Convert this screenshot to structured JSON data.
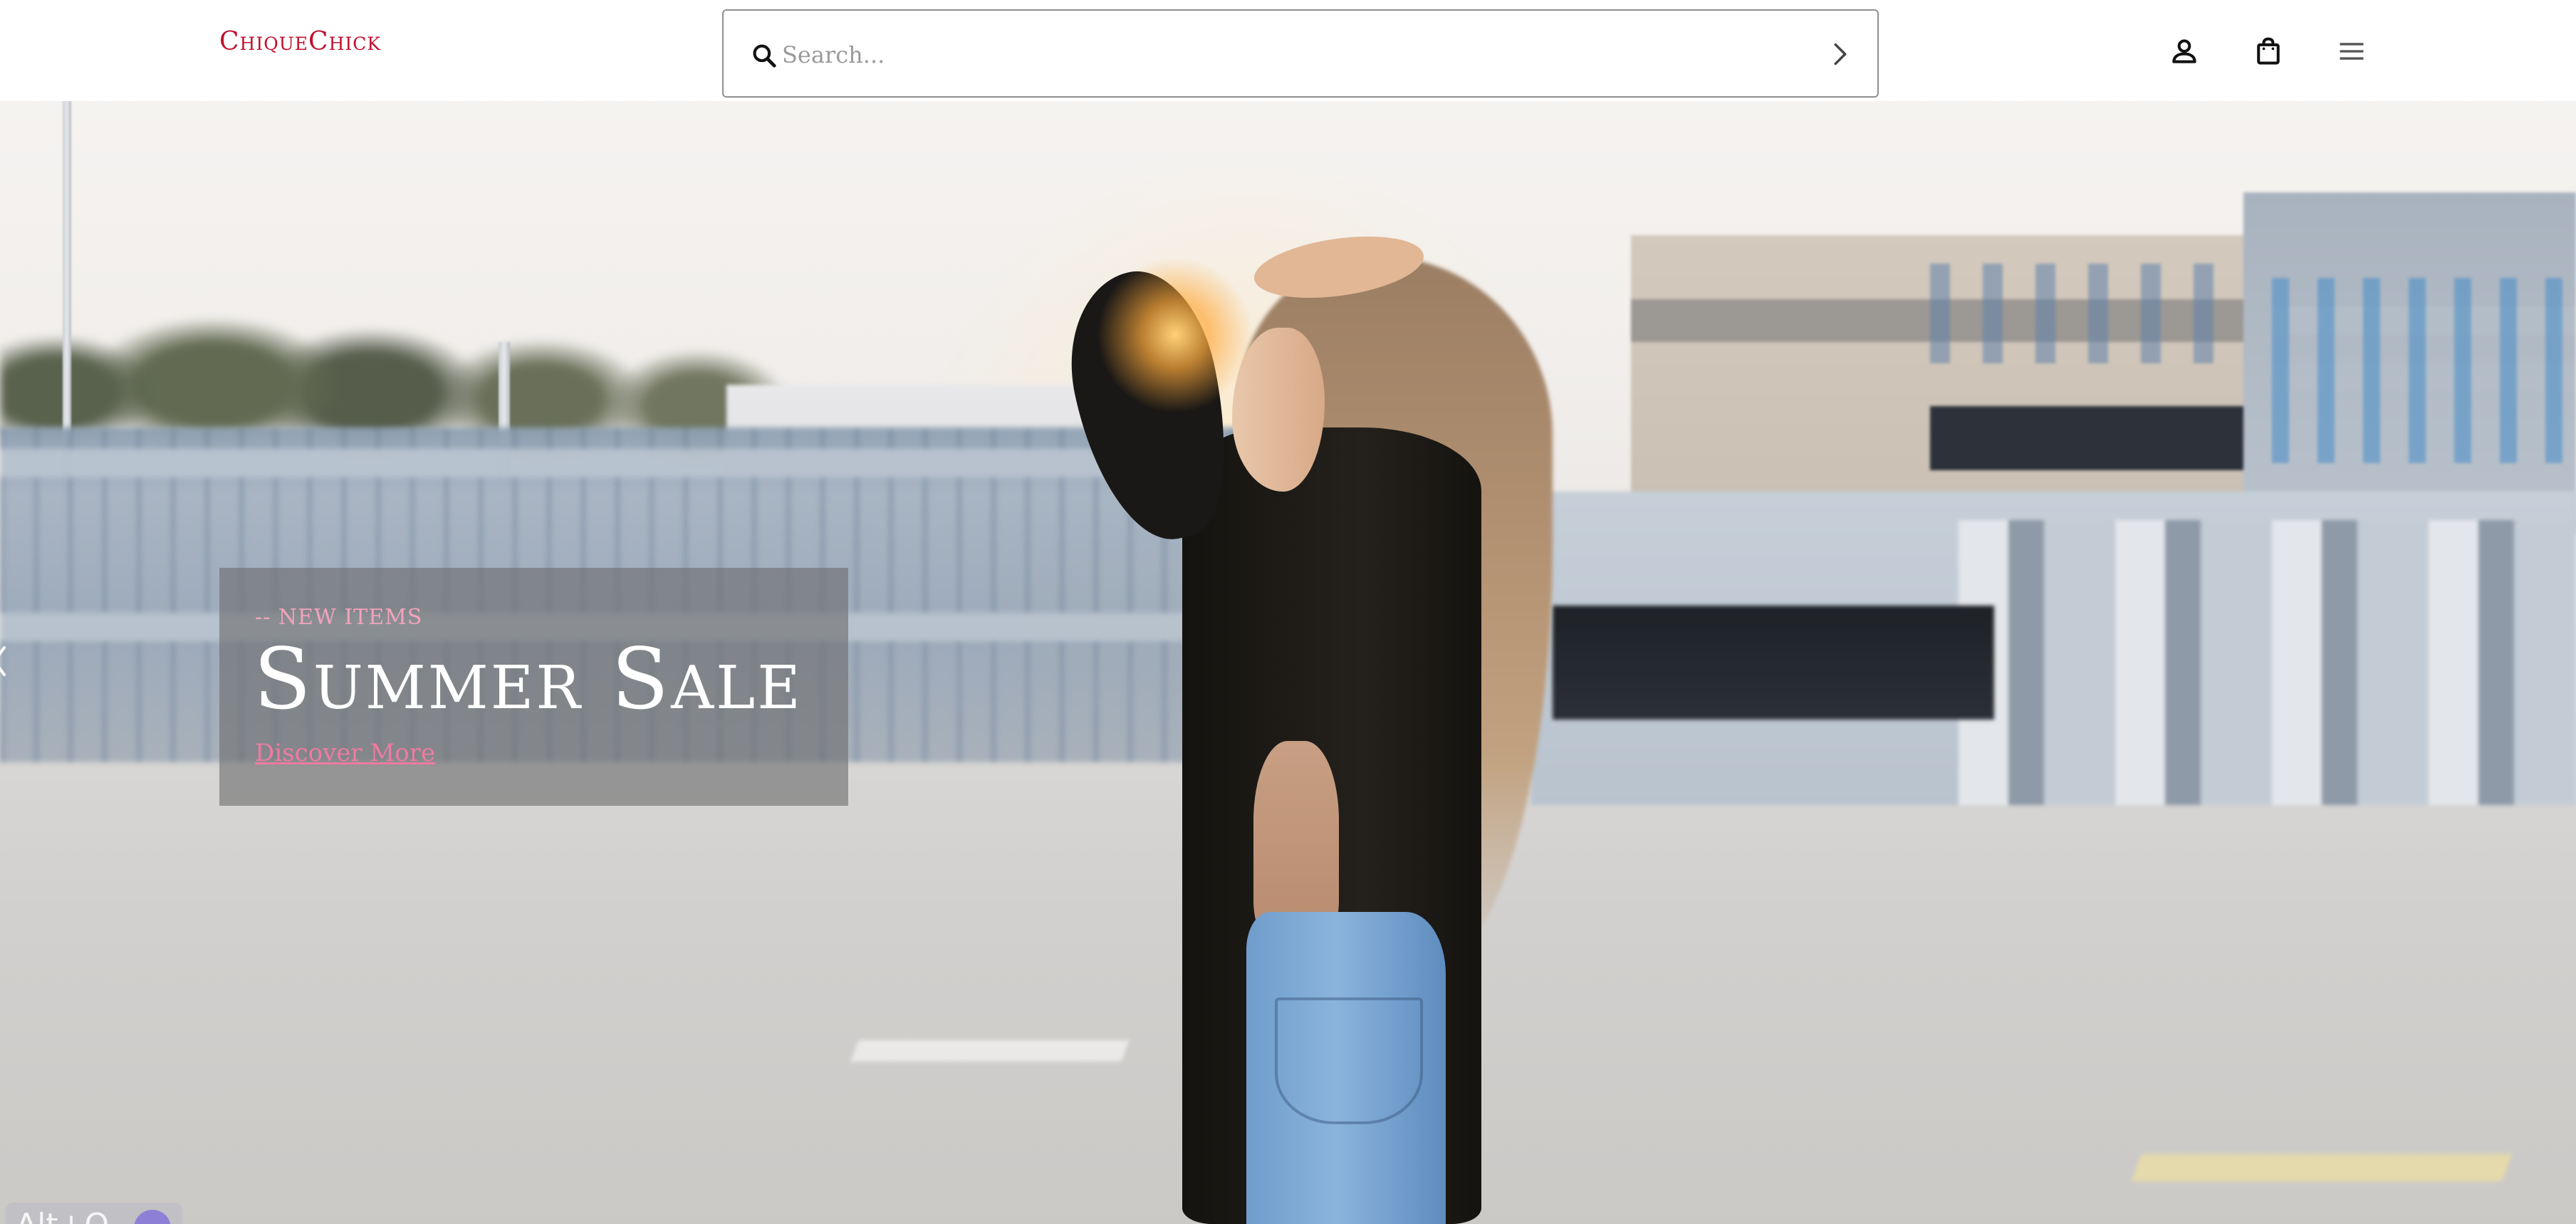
{
  "header": {
    "logo_text": "ChiqueChick",
    "search": {
      "placeholder": "Search...",
      "value": ""
    },
    "icons": {
      "search": "search-icon",
      "submit": "chevron-right-icon",
      "account": "user-icon",
      "cart": "shopping-bag-icon",
      "menu": "hamburger-menu-icon"
    }
  },
  "hero": {
    "eyebrow": "-- NEW ITEMS",
    "title": "Summer Sale",
    "cta_label": "Discover More",
    "prev_icon": "chevron-left-icon"
  },
  "overlay": {
    "shortcut_label": "Alt+O"
  },
  "colors": {
    "brand": "#c0102f",
    "accent_pink": "#f07aa0",
    "eyebrow_pink": "#f3a3bb",
    "promo_bg": "rgba(110,110,110,0.62)",
    "header_bg": "#ffffff"
  }
}
